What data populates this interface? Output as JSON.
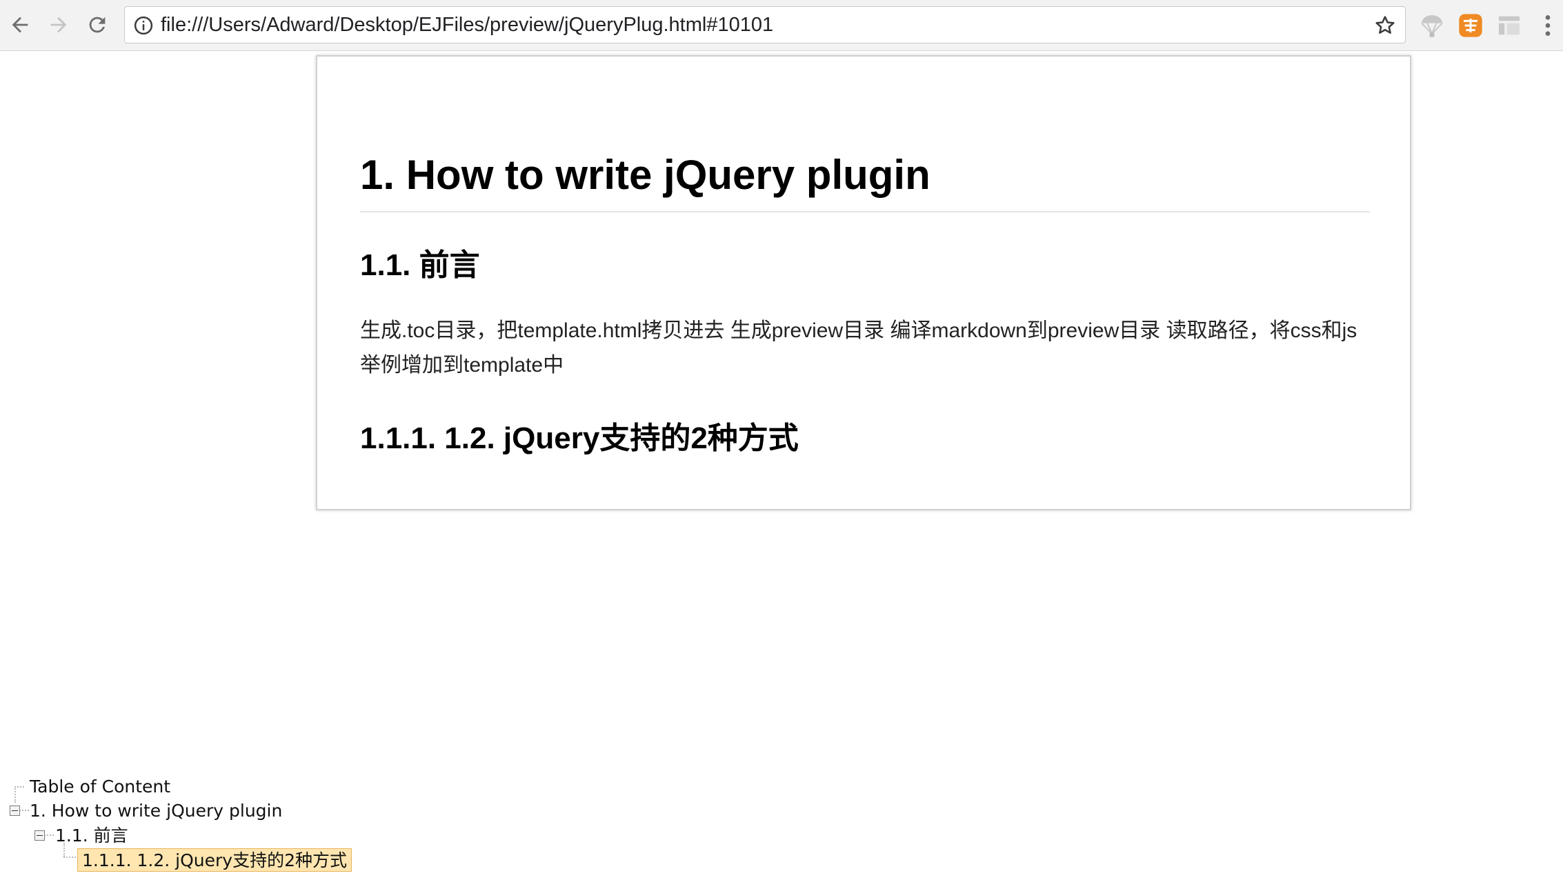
{
  "browser": {
    "url": "file:///Users/Adward/Desktop/EJFiles/preview/jQueryPlug.html#10101",
    "icons": {
      "back": "arrow-left-icon",
      "forward": "arrow-right-icon",
      "reload": "reload-icon",
      "info": "info-icon",
      "bookmark": "star-icon",
      "extensions": [
        "parachute-extension-icon",
        "orange-extension-icon",
        "layout-extension-icon"
      ],
      "menu": "kebab-menu-icon"
    },
    "accent_color": "#f08a24"
  },
  "article": {
    "h1": "1. How to write jQuery plugin",
    "h2": "1.1. 前言",
    "paragraph": "生成.toc目录，把template.html拷贝进去 生成preview目录 编译markdown到preview目录 读取路径，将css和js举例增加到template中",
    "h3": "1.1.1. 1.2. jQuery支持的2种方式"
  },
  "toc": {
    "root": "Table of Content",
    "items": [
      {
        "label": "1. How to write jQuery plugin"
      },
      {
        "label": "1.1. 前言"
      },
      {
        "label": "1.1.1. 1.2. jQuery支持的2种方式",
        "selected": true
      }
    ],
    "selected_bg": "#ffe6b0"
  }
}
